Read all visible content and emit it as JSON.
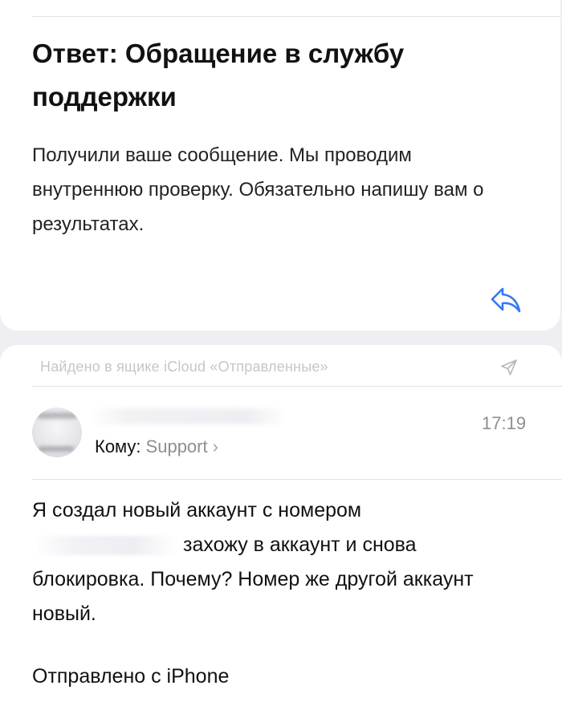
{
  "message_top": {
    "subject": "Ответ: Обращение в службу поддержки",
    "body": "Получили ваше сообщение. Мы проводим внутреннюю проверку. Обязательно напишу вам о результатах."
  },
  "message_bottom": {
    "found_in": "Найдено в ящике iCloud «Отправленные»",
    "time": "17:19",
    "to_label": "Кому:",
    "to_name": "Support",
    "to_chevron": "›",
    "body_line1": "Я создал новый аккаунт с номером",
    "body_line2_rest": "захожу в аккаунт и снова",
    "body_rest": "блокировка. Почему? Номер же другой аккаунт новый.",
    "signature": "Отправлено с iPhone"
  },
  "icons": {
    "reply": "reply-arrow-icon",
    "sent": "paper-plane-icon",
    "avatar": "avatar"
  },
  "colors": {
    "accent": "#3478f6",
    "muted": "#8e8e93",
    "faint": "#c6c6cb"
  }
}
